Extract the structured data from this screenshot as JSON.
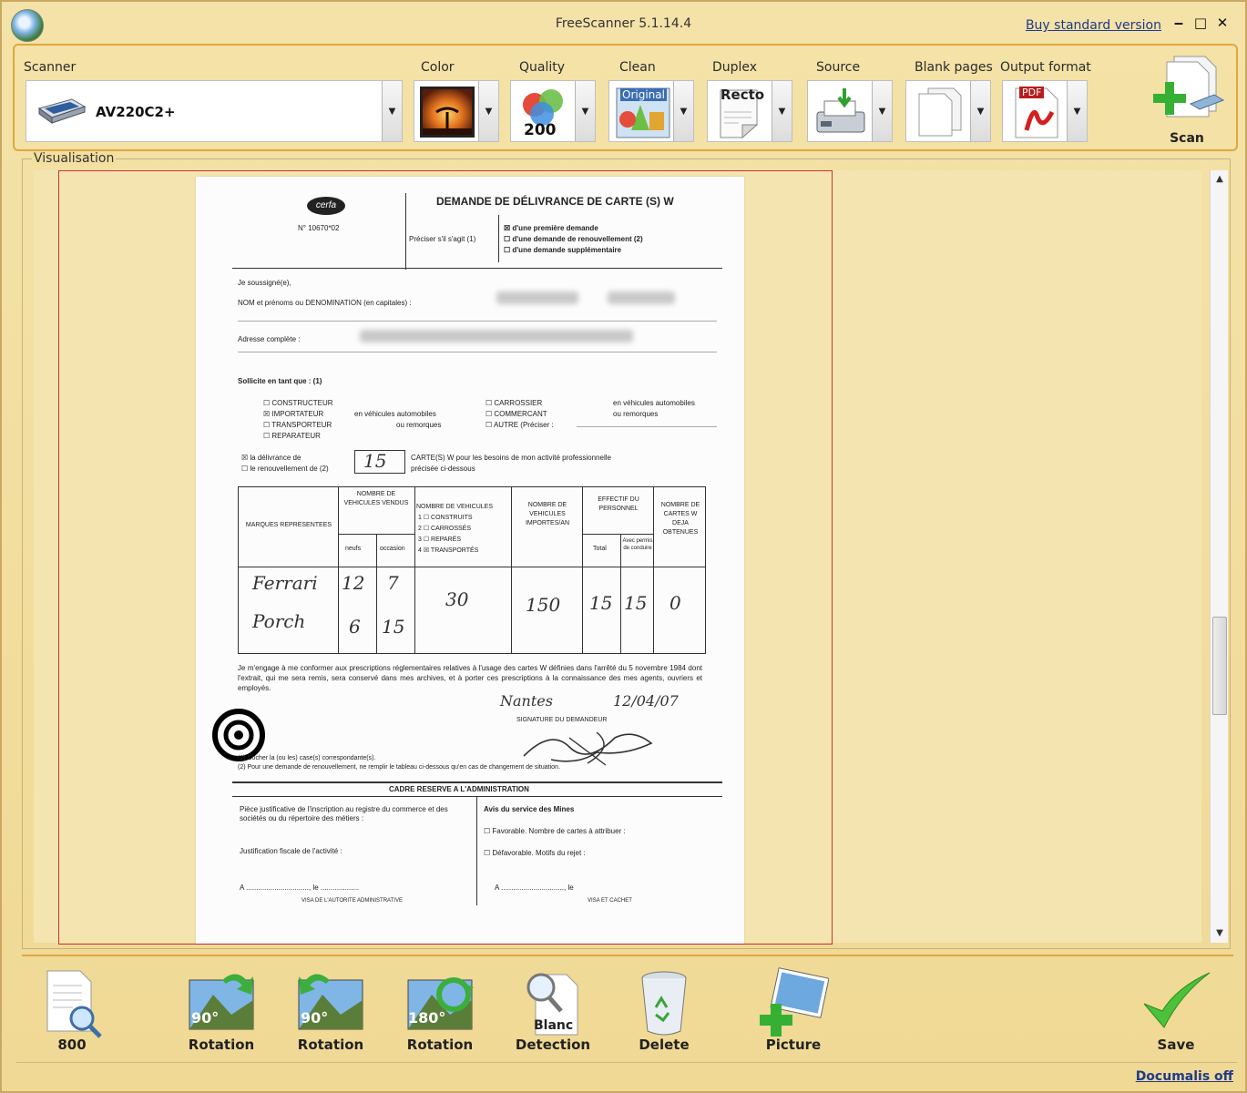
{
  "window": {
    "title": "FreeScanner 5.1.14.4",
    "buy_link": "Buy standard version",
    "minimize": "‒",
    "maximize": "□",
    "close": "✕"
  },
  "toolbar": {
    "scanner": {
      "label": "Scanner",
      "value": "AV220C2+"
    },
    "color": {
      "label": "Color"
    },
    "quality": {
      "label": "Quality",
      "value": "200"
    },
    "clean": {
      "label": "Clean",
      "value": "Original"
    },
    "duplex": {
      "label": "Duplex",
      "value": "Recto"
    },
    "source": {
      "label": "Source"
    },
    "blank_pages": {
      "label": "Blank pages"
    },
    "output_format": {
      "label": "Output format",
      "value": "PDF"
    },
    "scan": {
      "label": "Scan"
    }
  },
  "visualisation": {
    "legend": "Visualisation",
    "document": {
      "logo": "cerfa",
      "form_number": "N° 10670*02",
      "heading": "DEMANDE DE DÉLIVRANCE DE CARTE (S) W",
      "preciser": "Préciser s'il s'agit (1)",
      "opt1": "☒ d'une première demande",
      "opt2": "☐ d'une demande de renouvellement (2)",
      "opt3": "☐ d'une demande supplémentaire",
      "soussigne": "Je soussigné(e),",
      "nom_label": "NOM et prénoms ou DENOMINATION (en capitales) :",
      "adresse_label": "Adresse complète :",
      "sollicite": "Sollicite en tant que : (1)",
      "roles_left": [
        "☐ CONSTRUCTEUR",
        "☒ IMPORTATEUR",
        "☐ TRANSPORTEUR",
        "☐ REPARATEUR"
      ],
      "roles_left_note1": "en véhicules automobiles",
      "roles_left_note2": "ou remorques",
      "roles_right": [
        "☐ CARROSSIER",
        "☐ COMMERCANT",
        "☐ AUTRE (Préciser :"
      ],
      "roles_right_note1": "en véhicules automobiles",
      "roles_right_note2": "ou remorques",
      "delivrance": "☒ la délivrance de",
      "renouvellement": "☐ le renouvellement de (2)",
      "count": "15",
      "cartes_text": "CARTE(S) W pour les besoins de mon activité professionnelle",
      "precisee": "précisée ci-dessous",
      "table_headers": {
        "marques": "MARQUES REPRESENTEES",
        "nombre_vendus": "NOMBRE DE VEHICULES VENDUS",
        "neufs": "neufs",
        "occasion": "occasion",
        "nombre_vehicules": "NOMBRE DE VEHICULES",
        "construits": "1 ☐ CONSTRUITS",
        "carrosses": "2 ☐ CARROSSÉS",
        "repares": "3 ☐ REPARÉS",
        "transportes": "4 ☒ TRANSPORTÉS",
        "importes": "NOMBRE DE VEHICULES IMPORTES/AN",
        "effectif": "EFFECTIF DU PERSONNEL",
        "total": "Total",
        "avec_permis": "Avec permis de conduire",
        "nombre_cartes": "NOMBRE DE CARTES W DEJA OBTENUES"
      },
      "rows": [
        {
          "marque": "Ferrari",
          "neufs": "12",
          "occasion": "7"
        },
        {
          "marque": "Porch",
          "neufs": "6",
          "occasion": "15"
        }
      ],
      "shared": {
        "nombre_vehicules": "30",
        "importes": "150",
        "total": "15",
        "avec_permis": "15",
        "deja_obtenues": "0"
      },
      "engagement": "Je m'engage à me conformer aux prescriptions réglementaires relatives à l'usage des cartes W définies dans l'arrêté du 5 novembre 1984 dont l'extrait, qui me sera remis, sera conservé dans mes archives, et à porter ces prescriptions à la connaissance des mes agents, ouvriers et employés.",
      "lieu": "Nantes",
      "date": "12/04/07",
      "signature_label": "SIGNATURE DU DEMANDEUR",
      "note1": "(1) Cocher la (ou les) case(s) correspondante(s).",
      "note2": "(2) Pour une demande de renouvellement, ne remplir le tableau ci-dessous qu'en cas de changement de situation.",
      "admin_title": "CADRE RESERVE A L'ADMINISTRATION",
      "piece": "Pièce justificative de l'inscription au registre du commerce et des sociétés ou du répertoire des métiers :",
      "justif": "Justification fiscale de l'activité :",
      "avis": "Avis du service des Mines",
      "favorable": "☐ Favorable. Nombre de cartes à attribuer :",
      "defavorable": "☐ Défavorable. Motifs du rejet :",
      "a_le_left": "A ..............................., le ...................",
      "a_le_right": "A ..............................., le",
      "visa_left": "VISA DE L'AUTORITE ADMINISTRATIVE",
      "visa_right": "VISA ET CACHET"
    }
  },
  "bottom": {
    "pages": "800",
    "rotate_right": "Rotation",
    "rotate_right_angle": "90°",
    "rotate_left": "Rotation",
    "rotate_left_angle": "90°",
    "rotate_180": "Rotation",
    "rotate_180_angle": "180°",
    "detection": "Detection",
    "detection_badge": "Blanc",
    "delete": "Delete",
    "picture": "Picture",
    "save": "Save"
  },
  "status": {
    "link": "Documalis off"
  },
  "colors": {
    "background": "#f4e2a8",
    "frame_orange": "#e0a640",
    "page_border": "#cc3333",
    "link_blue": "#1f3a8a"
  }
}
